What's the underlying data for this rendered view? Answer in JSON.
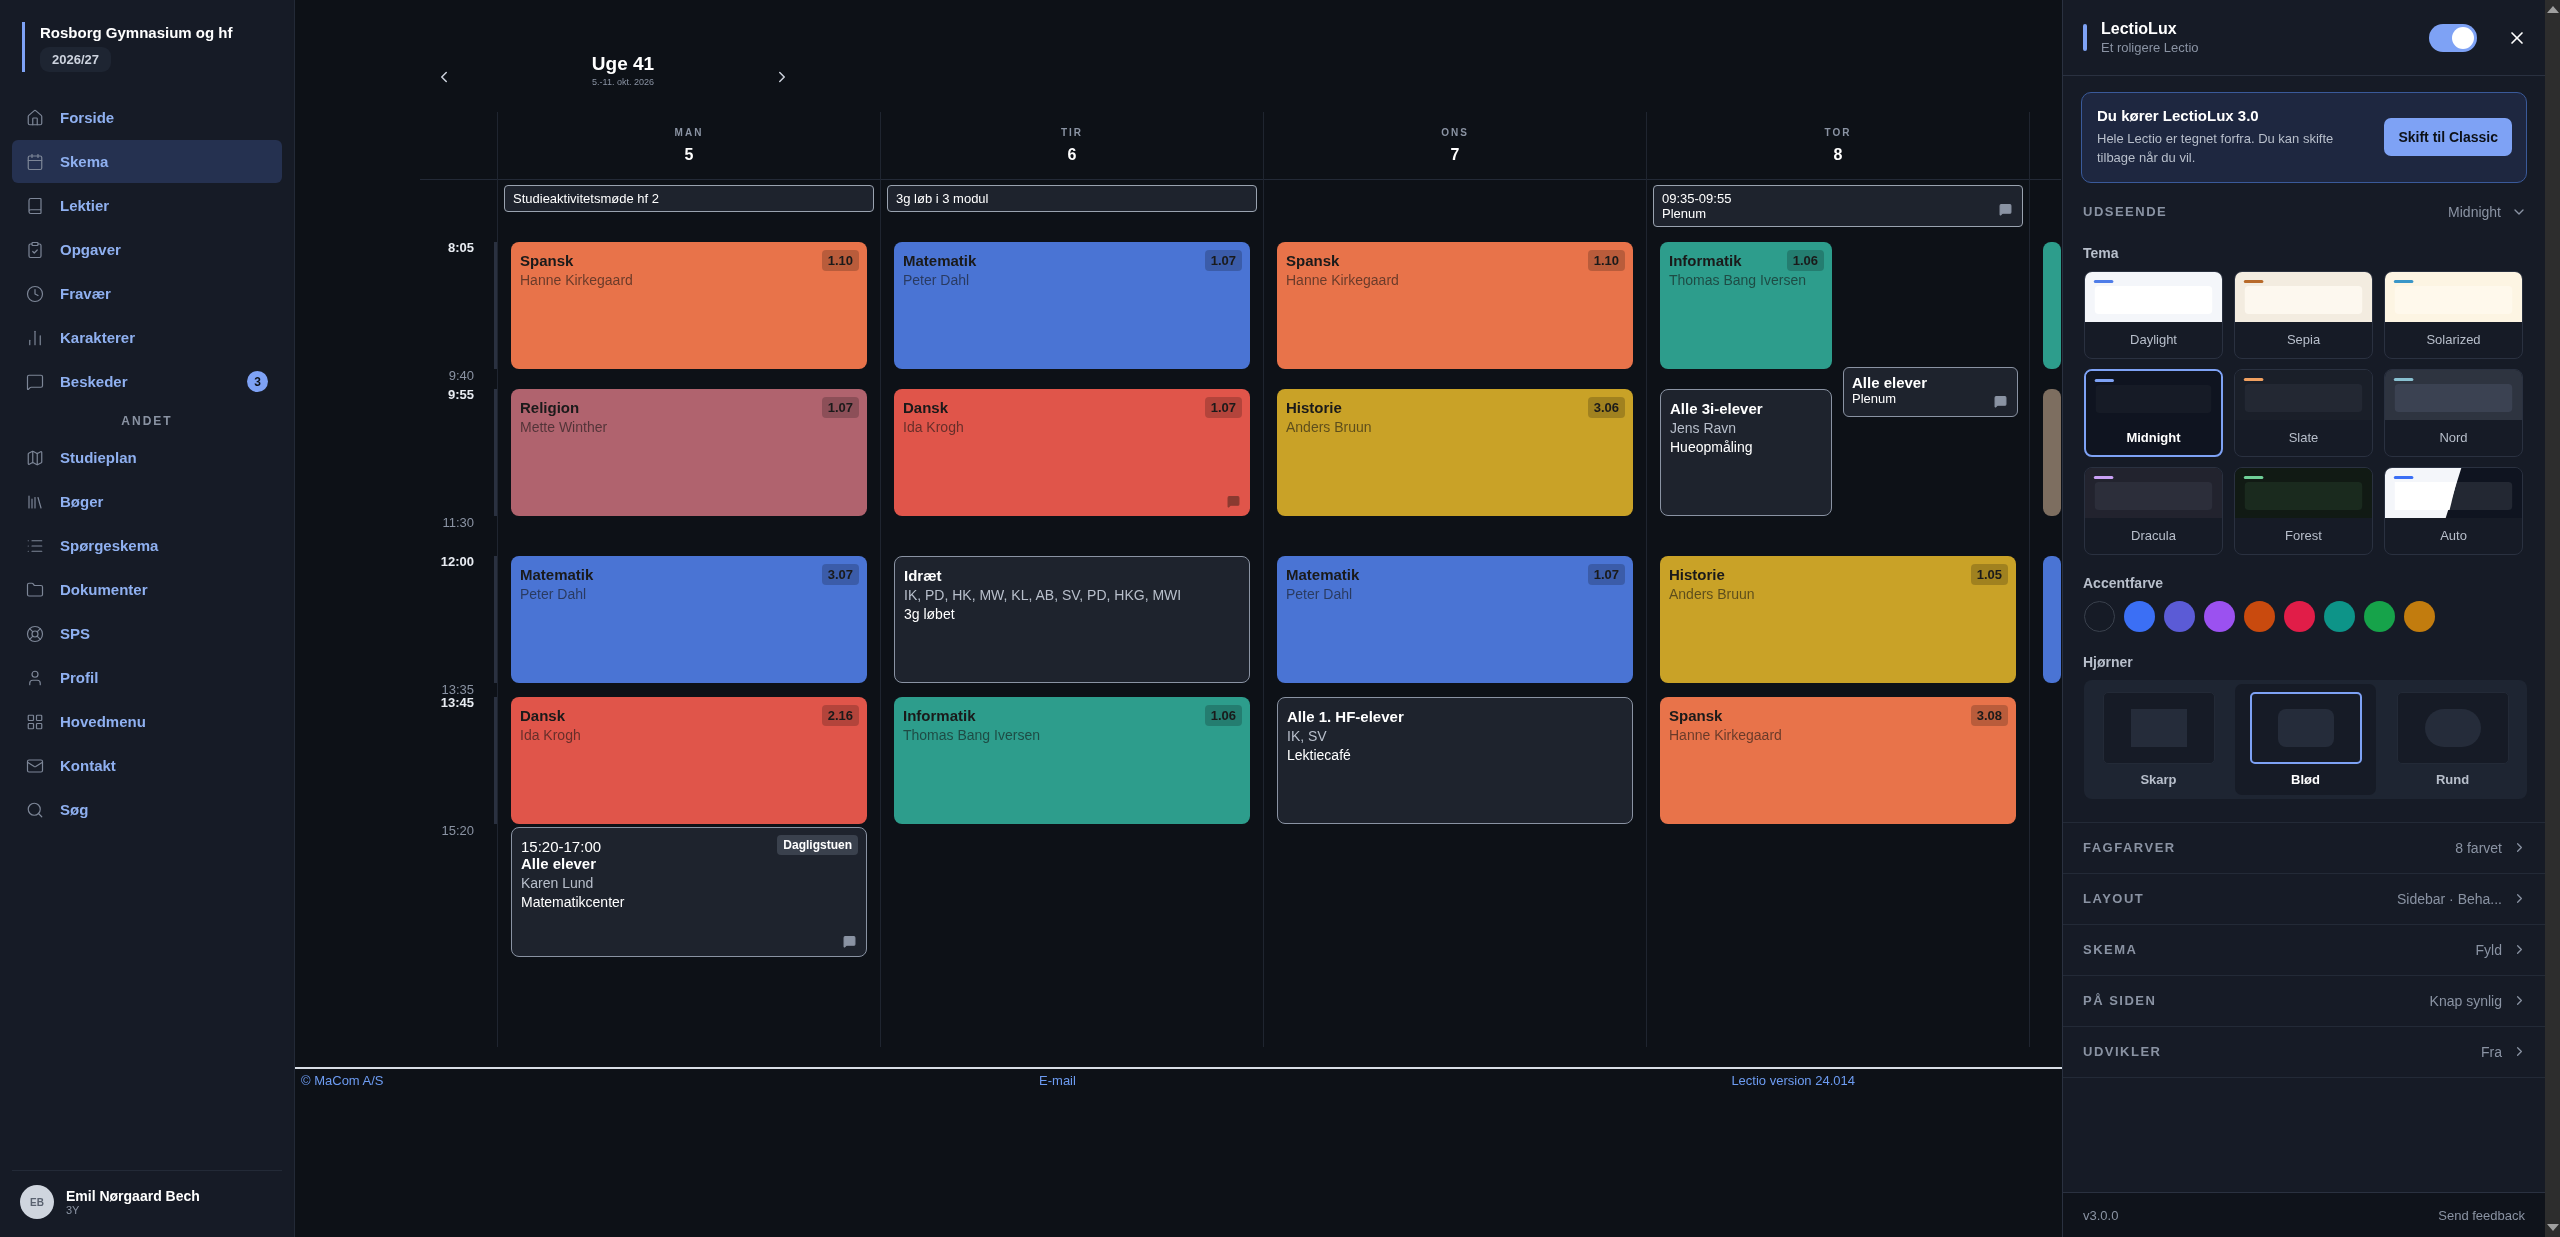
{
  "sidebar": {
    "school": "Rosborg Gymnasium og hf",
    "year": "2026/27",
    "items": [
      {
        "label": "Forside",
        "selected": false
      },
      {
        "label": "Skema",
        "selected": true
      },
      {
        "label": "Lektier",
        "selected": false
      },
      {
        "label": "Opgaver",
        "selected": false
      },
      {
        "label": "Fravær",
        "selected": false
      },
      {
        "label": "Karakterer",
        "selected": false
      },
      {
        "label": "Beskeder",
        "selected": false,
        "badge": "3"
      }
    ],
    "section_label": "ANDET",
    "more_items": [
      {
        "label": "Studieplan",
        "selected": false
      },
      {
        "label": "Bøger",
        "selected": false
      },
      {
        "label": "Spørgeskema",
        "selected": false
      },
      {
        "label": "Dokumenter",
        "selected": false
      },
      {
        "label": "SPS",
        "selected": false
      },
      {
        "label": "Profil",
        "selected": false
      },
      {
        "label": "Hovedmenu",
        "selected": false
      },
      {
        "label": "Kontakt",
        "selected": false
      },
      {
        "label": "Søg",
        "selected": false
      }
    ],
    "user": {
      "initials": "EB",
      "name": "Emil Nørgaard Bech",
      "class": "3Y"
    }
  },
  "week": {
    "title": "Uge 41",
    "dates": "5.-11. okt. 2026"
  },
  "time_blocks": [
    {
      "start": "8:05",
      "end": "9:40"
    },
    {
      "start": "9:55",
      "end": "11:30"
    },
    {
      "start": "12:00",
      "end": "13:35"
    },
    {
      "start": "13:45",
      "end": "15:20"
    }
  ],
  "days": [
    {
      "kind": "full",
      "weekday": "MAN",
      "date": "5",
      "all_day": [
        {
          "text": "Studieaktivitetsmøde hf 2"
        }
      ],
      "slots": [
        [
          {
            "kind": "lesson",
            "subject": "Spansk",
            "teacher": "Hanne Kirkegaard",
            "room": "1.10",
            "color": "#e8734a"
          }
        ],
        [
          {
            "kind": "lesson",
            "subject": "Religion",
            "teacher": "Mette Winther",
            "room": "1.07",
            "color": "#b0636e"
          }
        ],
        [
          {
            "kind": "lesson",
            "subject": "Matematik",
            "teacher": "Peter Dahl",
            "room": "3.07",
            "color": "#4a74d4"
          }
        ],
        [
          {
            "kind": "lesson",
            "subject": "Dansk",
            "teacher": "Ida Krogh",
            "room": "2.16",
            "color": "#e0554a"
          }
        ]
      ],
      "after": [
        {
          "kind": "activity",
          "time": "15:20-17:00",
          "tag": "Dagligstuen",
          "title": "Alle elever",
          "people": "Karen Lund",
          "note": "Matematikcenter",
          "comment": true
        }
      ]
    },
    {
      "kind": "full",
      "weekday": "TIR",
      "date": "6",
      "all_day": [
        {
          "text": "3g løb i 3 modul"
        }
      ],
      "slots": [
        [
          {
            "kind": "lesson",
            "subject": "Matematik",
            "teacher": "Peter Dahl",
            "room": "1.07",
            "color": "#4a74d4"
          }
        ],
        [
          {
            "kind": "lesson",
            "subject": "Dansk",
            "teacher": "Ida Krogh",
            "room": "1.07",
            "color": "#e0554a",
            "comment": true
          }
        ],
        [
          {
            "kind": "activity",
            "title": "Idræt",
            "people": "IK, PD, HK, MW, KL, AB, SV, PD, HKG, MWI",
            "note": "3g løbet"
          }
        ],
        [
          {
            "kind": "lesson",
            "subject": "Informatik",
            "teacher": "Thomas Bang Iversen",
            "room": "1.06",
            "color": "#2d9d8c"
          }
        ]
      ]
    },
    {
      "kind": "full",
      "weekday": "ONS",
      "date": "7",
      "slots": [
        [
          {
            "kind": "lesson",
            "subject": "Spansk",
            "teacher": "Hanne Kirkegaard",
            "room": "1.10",
            "color": "#e8734a"
          }
        ],
        [
          {
            "kind": "lesson",
            "subject": "Historie",
            "teacher": "Anders Bruun",
            "room": "3.06",
            "color": "#c9a227"
          }
        ],
        [
          {
            "kind": "lesson",
            "subject": "Matematik",
            "teacher": "Peter Dahl",
            "room": "1.07",
            "color": "#4a74d4"
          }
        ],
        [
          {
            "kind": "activity",
            "title": "Alle 1. HF-elever",
            "people": "IK, SV",
            "note": "Lektiecafé"
          }
        ]
      ]
    },
    {
      "kind": "full",
      "weekday": "TOR",
      "date": "8",
      "all_day": [
        {
          "time": "09:35-09:55",
          "text": "Plenum",
          "comment": true
        }
      ],
      "slots": [
        [
          {
            "kind": "lesson",
            "subject": "Informatik",
            "teacher": "Thomas Bang Iversen",
            "room": "1.06",
            "color": "#2d9d8c",
            "half": true
          }
        ],
        [
          {
            "kind": "activity",
            "title": "Alle 3i-elever",
            "people": "Jens Ravn",
            "note": "Hueopmåling",
            "half": true
          },
          {
            "kind": "popover",
            "title": "Alle elever",
            "note": "Plenum",
            "comment": true
          }
        ],
        [
          {
            "kind": "lesson",
            "subject": "Historie",
            "teacher": "Anders Bruun",
            "room": "1.05",
            "color": "#c9a227"
          }
        ],
        [
          {
            "kind": "lesson",
            "subject": "Spansk",
            "teacher": "Hanne Kirkegaard",
            "room": "3.08",
            "color": "#e8734a"
          }
        ]
      ]
    },
    {
      "kind": "partial",
      "slots": [
        [
          {
            "kind": "lesson",
            "color": "#2d9d8c"
          }
        ],
        [
          {
            "kind": "lesson",
            "color": "#7d6e60"
          }
        ],
        [
          {
            "kind": "lesson",
            "color": "#4a74d4"
          }
        ]
      ]
    }
  ],
  "footer": {
    "copyright": "© MaCom A/S",
    "email": "E-mail",
    "version": "Lectio version 24.014"
  },
  "panel": {
    "title": "LectioLux",
    "subtitle": "Et roligere Lectio",
    "enabled": true,
    "banner": {
      "title": "Du kører LectioLux 3.0",
      "text": "Hele Lectio er tegnet forfra. Du kan skifte tilbage når du vil.",
      "button": "Skift til Classic"
    },
    "appearance": {
      "label": "UDSEENDE",
      "value": "Midnight",
      "expanded": true,
      "theme_label": "Tema",
      "themes": [
        {
          "name": "Daylight",
          "color": "#4f7de8",
          "selected": false
        },
        {
          "name": "Sepia",
          "color": "#b86a2a",
          "selected": false
        },
        {
          "name": "Solarized",
          "color": "#3a96c8",
          "selected": false
        },
        {
          "name": "Midnight",
          "color": "#7ea2f5",
          "selected": true
        },
        {
          "name": "Slate",
          "color": "#f0a060",
          "selected": false
        },
        {
          "name": "Nord",
          "color": "#88c0d0",
          "selected": false
        },
        {
          "name": "Dracula",
          "color": "#c9a0f5",
          "selected": false
        },
        {
          "name": "Forest",
          "color": "#6fcf97",
          "selected": false
        },
        {
          "name": "Auto",
          "color": "#3b6ff5",
          "selected": false
        }
      ],
      "accent_label": "Accentfarve",
      "accents": [
        {
          "color": "#161b26",
          "selected": false
        },
        {
          "color": "#3b6ff5",
          "selected": false
        },
        {
          "color": "#5b5bd6",
          "selected": false
        },
        {
          "color": "#9b51f0",
          "selected": false
        },
        {
          "color": "#c94a0e",
          "selected": false
        },
        {
          "color": "#e11d48",
          "selected": false
        },
        {
          "color": "#0d9488",
          "selected": false
        },
        {
          "color": "#16a34a",
          "selected": false
        },
        {
          "color": "#c27c0e",
          "selected": false
        }
      ],
      "corner_label": "Hjørner",
      "corners": [
        {
          "label": "Skarp",
          "selected": false
        },
        {
          "label": "Blød",
          "selected": true
        },
        {
          "label": "Rund",
          "selected": false
        }
      ]
    },
    "rows": [
      {
        "label": "FAGFARVER",
        "value": "8 farvet"
      },
      {
        "label": "LAYOUT",
        "value": "Sidebar · Beha..."
      },
      {
        "label": "SKEMA",
        "value": "Fyld"
      },
      {
        "label": "PÅ SIDEN",
        "value": "Knap synlig"
      },
      {
        "label": "UDVIKLER",
        "value": "Fra"
      }
    ],
    "version": "v3.0.0",
    "feedback": "Send feedback"
  }
}
